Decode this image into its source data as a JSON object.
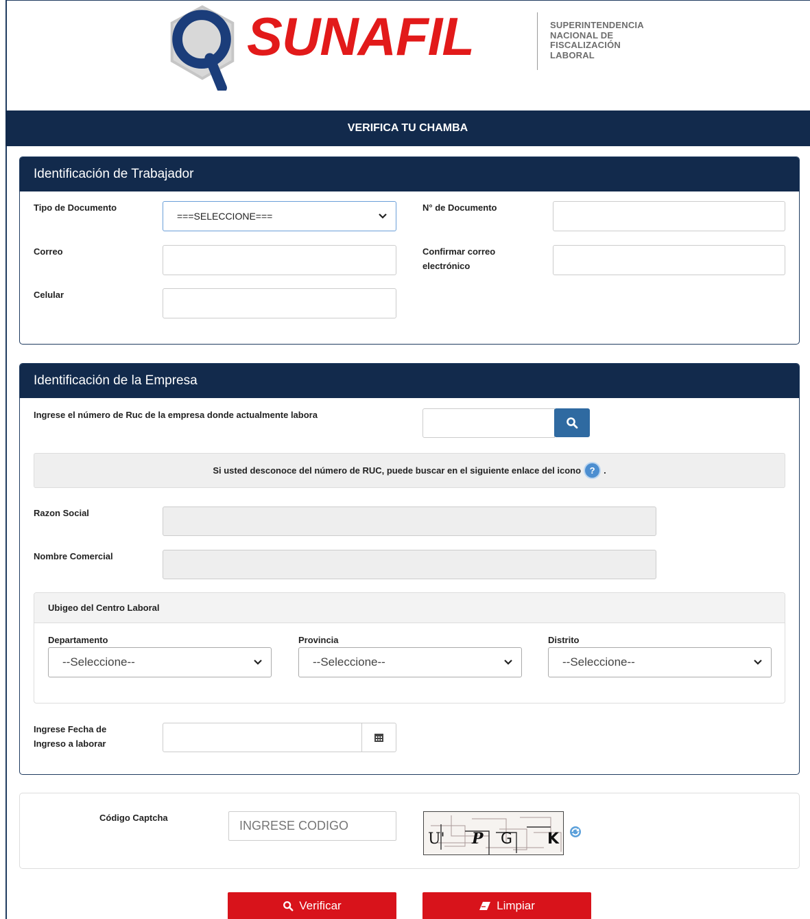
{
  "logo": {
    "text": "SUNAFIL",
    "subtitle_lines": [
      "SUPERINTENDENCIA",
      "NACIONAL DE",
      "FISCALIZACIÓN",
      "LABORAL"
    ]
  },
  "page_title": "VERIFICA TU CHAMBA",
  "worker": {
    "heading": "Identificación de Trabajador",
    "doc_type_label": "Tipo de Documento",
    "doc_type_value": "===SELECCIONE===",
    "doc_number_label": "N° de Documento",
    "email_label": "Correo",
    "confirm_email_label_1": "Confirmar correo",
    "confirm_email_label_2": "electrónico",
    "phone_label": "Celular"
  },
  "company": {
    "heading": "Identificación de la Empresa",
    "ruc_label": "Ingrese el número de Ruc de la empresa donde actualmente labora",
    "info_text": "Si usted desconoce del número de RUC, puede buscar en el siguiente enlace del icono",
    "info_suffix": ".",
    "business_name_label": "Razon Social",
    "trade_name_label": "Nombre Comercial",
    "ubigeo": {
      "heading": "Ubigeo del Centro Laboral",
      "department_label": "Departamento",
      "department_value": "--Seleccione--",
      "province_label": "Provincia",
      "province_value": "--Seleccione--",
      "district_label": "Distrito",
      "district_value": "--Seleccione--"
    },
    "start_date_label_1": "Ingrese Fecha de",
    "start_date_label_2": "Ingreso a laborar"
  },
  "captcha": {
    "label": "Código Captcha",
    "placeholder": "INGRESE CODIGO",
    "image_text": "U P G K"
  },
  "buttons": {
    "verify": "Verificar",
    "clear": "Limpiar"
  },
  "colors": {
    "navy": "#122a4c",
    "brand_red": "#e21a1a",
    "button_red": "#d8131b",
    "search_blue": "#2f6aa1"
  }
}
